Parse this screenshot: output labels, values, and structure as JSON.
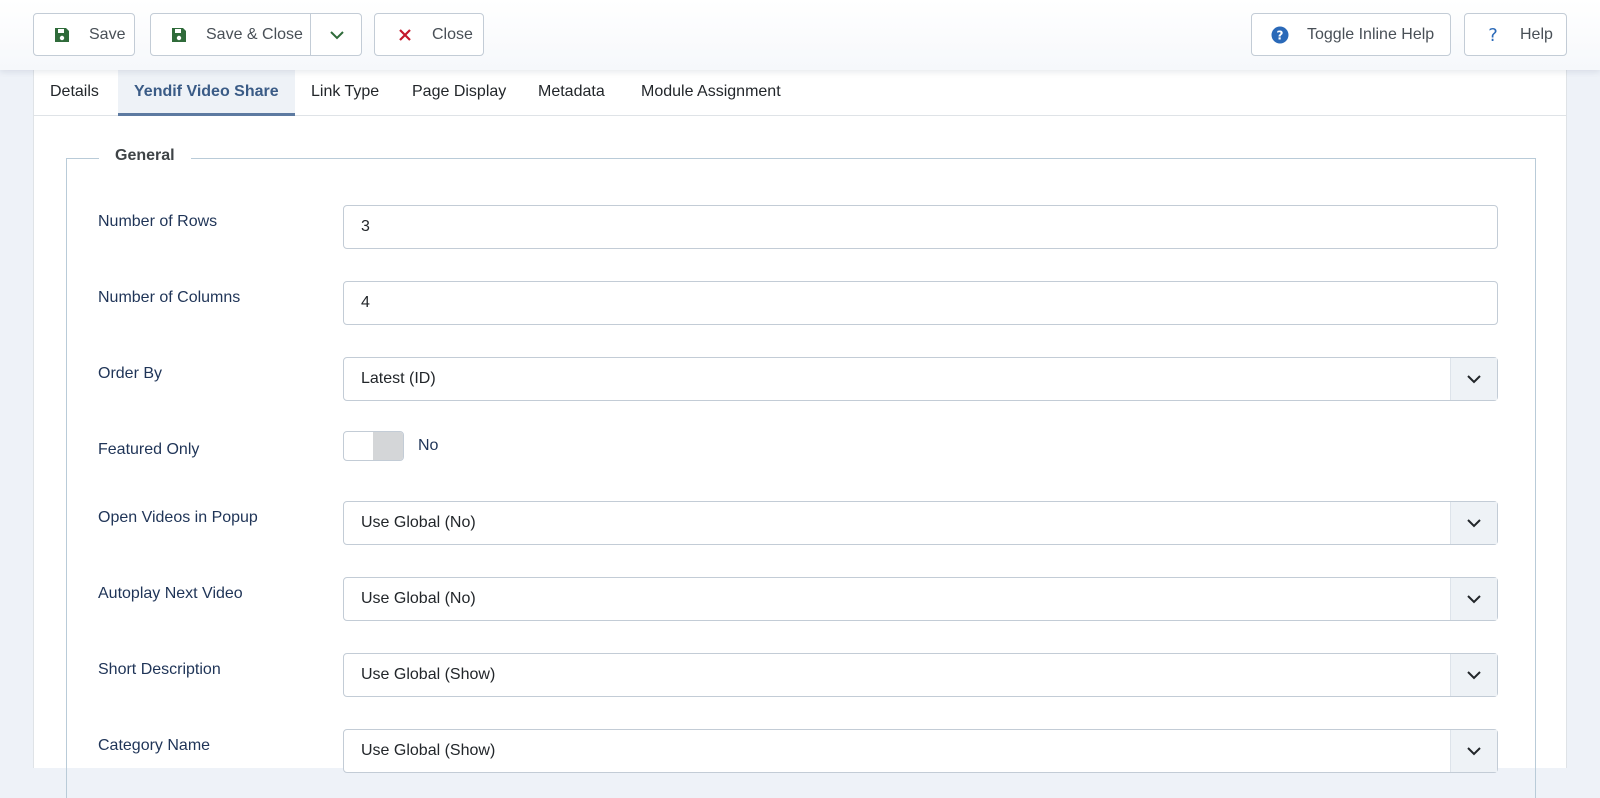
{
  "toolbar": {
    "save_label": "Save",
    "save_close_label": "Save & Close",
    "close_label": "Close",
    "toggle_help_label": "Toggle Inline Help",
    "help_label": "Help"
  },
  "tabs": [
    {
      "label": "Details",
      "active": false
    },
    {
      "label": "Yendif Video Share",
      "active": true
    },
    {
      "label": "Link Type",
      "active": false
    },
    {
      "label": "Page Display",
      "active": false
    },
    {
      "label": "Metadata",
      "active": false
    },
    {
      "label": "Module Assignment",
      "active": false
    }
  ],
  "fieldset": {
    "legend": "General",
    "fields": {
      "rows": {
        "label": "Number of Rows",
        "value": "3"
      },
      "columns": {
        "label": "Number of Columns",
        "value": "4"
      },
      "order_by": {
        "label": "Order By",
        "value": "Latest (ID)"
      },
      "featured": {
        "label": "Featured Only",
        "value": "No",
        "on": false
      },
      "popup": {
        "label": "Open Videos in Popup",
        "value": "Use Global (No)"
      },
      "autoplay": {
        "label": "Autoplay Next Video",
        "value": "Use Global (No)"
      },
      "short_desc": {
        "label": "Short Description",
        "value": "Use Global (Show)"
      },
      "category": {
        "label": "Category Name",
        "value": "Use Global (Show)"
      }
    }
  },
  "colors": {
    "accent": "#3a5b86",
    "save_icon": "#2f6b3a",
    "close_icon": "#c4172b",
    "help_icon": "#2a69b8",
    "background": "#eef2f8"
  },
  "icons": {
    "save": "floppy-disk-icon",
    "dropdown": "chevron-down-icon",
    "close": "x-icon",
    "toggle_help": "question-circle-icon",
    "help": "question-mark-icon"
  }
}
